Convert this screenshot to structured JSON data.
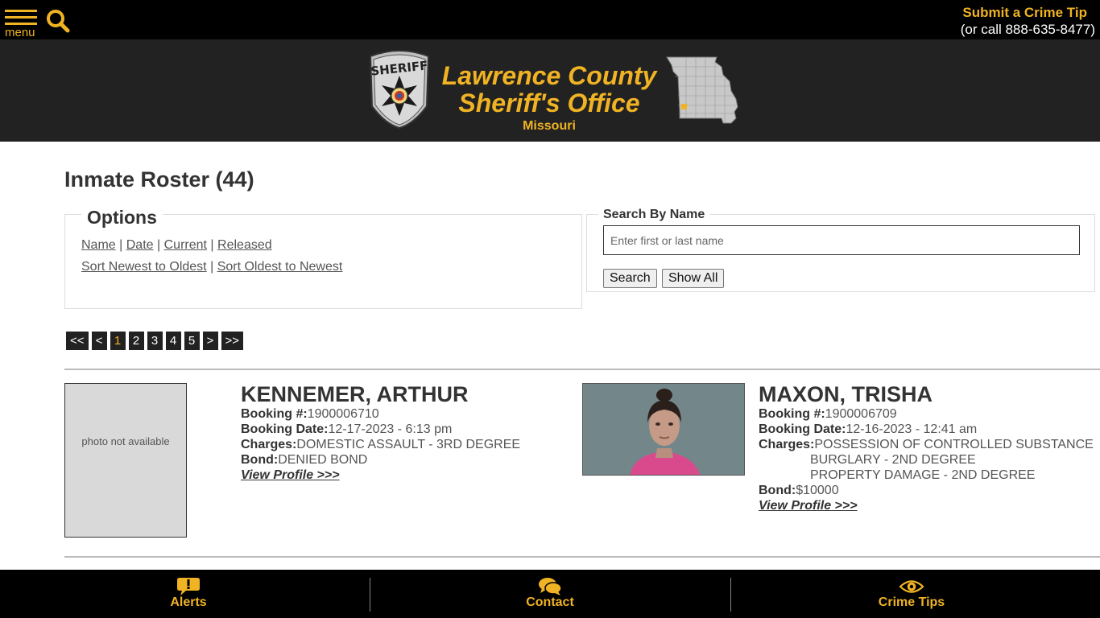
{
  "topbar": {
    "menu_label": "menu",
    "crime_tip_title": "Submit a Crime Tip",
    "crime_tip_phone": "(or call 888-635-8477)"
  },
  "header": {
    "title_line1": "Lawrence County",
    "title_line2": "Sheriff's Office",
    "subtitle": "Missouri",
    "badge_text": "SHERIFF"
  },
  "page": {
    "title": "Inmate Roster (44)"
  },
  "options": {
    "legend": "Options",
    "sort_links": [
      "Name",
      "Date",
      "Current",
      "Released"
    ],
    "order_links": [
      "Sort Newest to Oldest",
      "Sort Oldest to Newest"
    ]
  },
  "search": {
    "legend": "Search By Name",
    "placeholder": "Enter first or last name",
    "search_label": "Search",
    "show_all_label": "Show All"
  },
  "pagination": {
    "first": "<<",
    "prev": "<",
    "pages": [
      "1",
      "2",
      "3",
      "4",
      "5"
    ],
    "current": "1",
    "next": ">",
    "last": ">>"
  },
  "inmates": [
    {
      "name": "KENNEMER, ARTHUR",
      "photo_text": "photo not available",
      "booking_no_label": "Booking #:",
      "booking_no": "1900006710",
      "booking_date_label": "Booking Date:",
      "booking_date": "12-17-2023 - 6:13 pm",
      "charges_label": "Charges:",
      "charges": [
        "DOMESTIC ASSAULT - 3RD DEGREE"
      ],
      "bond_label": "Bond:",
      "bond": "DENIED BOND",
      "profile_link": "View Profile >>>"
    },
    {
      "name": "MAXON, TRISHA",
      "booking_no_label": "Booking #:",
      "booking_no": "1900006709",
      "booking_date_label": "Booking Date:",
      "booking_date": "12-16-2023 - 12:41 am",
      "charges_label": "Charges:",
      "charges": [
        "POSSESSION OF CONTROLLED SUBSTANCE",
        "BURGLARY - 2ND DEGREE",
        "PROPERTY DAMAGE - 2ND DEGREE"
      ],
      "bond_label": "Bond:",
      "bond": "$10000",
      "profile_link": "View Profile >>>"
    }
  ],
  "footer": {
    "items": [
      {
        "label": "Alerts",
        "icon": "alert-bubble-icon"
      },
      {
        "label": "Contact",
        "icon": "chat-bubbles-icon"
      },
      {
        "label": "Crime Tips",
        "icon": "eye-icon"
      }
    ]
  },
  "colors": {
    "accent": "#f0b323",
    "header_bg": "#222222",
    "topbar_bg": "#000000"
  }
}
